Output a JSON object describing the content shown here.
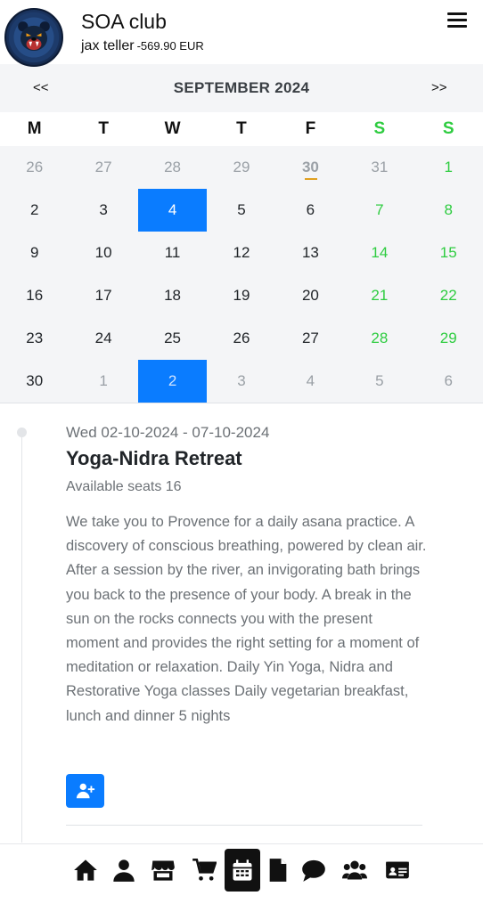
{
  "header": {
    "club_name": "SOA club",
    "user_name": "jax teller",
    "balance": "-569.90 EUR",
    "menu_icon": "hamburger-menu-icon",
    "avatar_icon": "bear-logo-avatar"
  },
  "calendar": {
    "prev_label": "<<",
    "next_label": ">>",
    "month_title": "SEPTEMBER 2024",
    "weekdays": [
      "M",
      "T",
      "W",
      "T",
      "F",
      "S",
      "S"
    ],
    "weeks": [
      [
        "26",
        "27",
        "28",
        "29",
        "30",
        "31",
        "1"
      ],
      [
        "2",
        "3",
        "4",
        "5",
        "6",
        "7",
        "8"
      ],
      [
        "9",
        "10",
        "11",
        "12",
        "13",
        "14",
        "15"
      ],
      [
        "16",
        "17",
        "18",
        "19",
        "20",
        "21",
        "22"
      ],
      [
        "23",
        "24",
        "25",
        "26",
        "27",
        "28",
        "29"
      ],
      [
        "30",
        "1",
        "2",
        "3",
        "4",
        "5",
        "6"
      ]
    ],
    "today": "30",
    "selected_days": [
      "4",
      "2"
    ],
    "colors": {
      "weekend": "#2ecc40",
      "selected": "#0a7cff",
      "today_marker": "#e0a020"
    }
  },
  "event": {
    "date_range": "Wed 02-10-2024 - 07-10-2024",
    "title": "Yoga-Nidra Retreat",
    "seats": "Available seats 16",
    "description": "We take you to Provence for a daily asana practice. A discovery of conscious breathing, powered by clean air. After a session by the river, an invigorating bath brings you back to the presence of your body. A break in the sun on the rocks connects you with the present moment and provides the right setting for a moment of meditation or relaxation. Daily Yin Yoga, Nidra and Restorative Yoga classes Daily vegetarian breakfast, lunch and dinner 5 nights",
    "join_icon": "user-plus-icon"
  },
  "bottom_nav": {
    "items": [
      "home-icon",
      "user-icon",
      "store-icon",
      "cart-icon",
      "calendar-icon",
      "document-icon",
      "chat-icon",
      "users-icon",
      "id-card-icon"
    ],
    "active": "calendar-icon"
  }
}
